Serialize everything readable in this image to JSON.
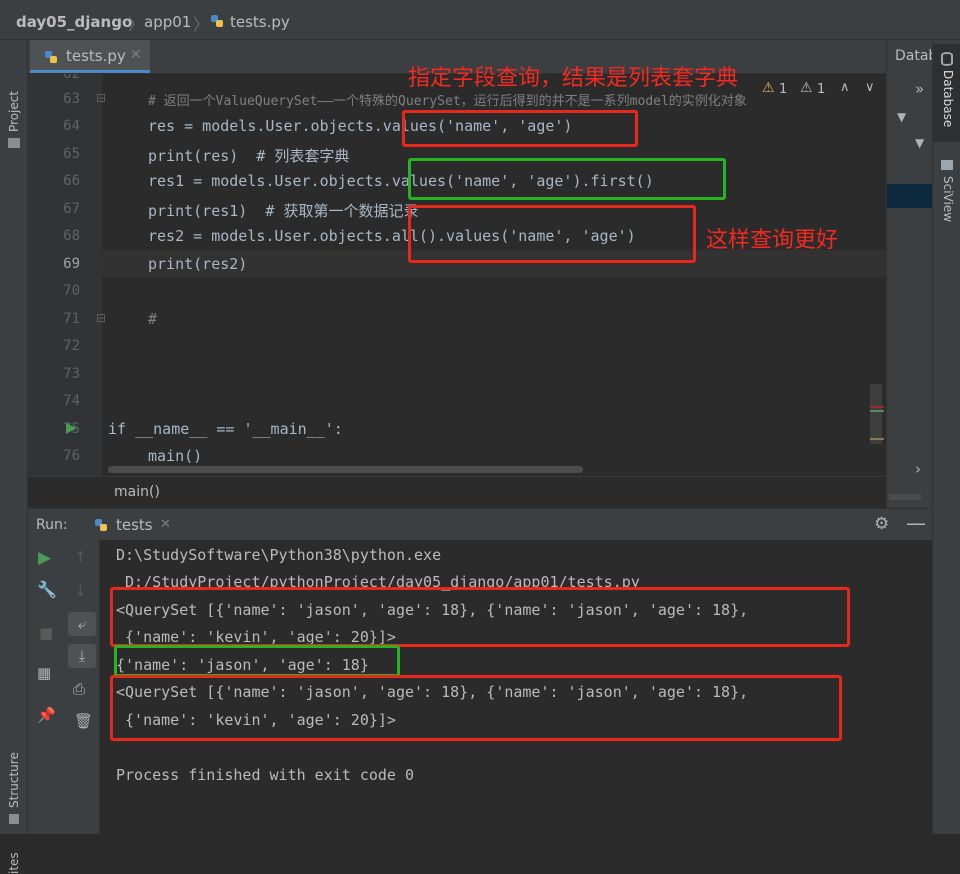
{
  "navbar": {
    "project": "day05_django",
    "module": "app01",
    "file": "tests.py",
    "warn1": "1",
    "warn2": "1"
  },
  "left_toolwindows": {
    "project": "Project",
    "structure": "Structure",
    "favorites": "ites"
  },
  "right_toolwindows": {
    "database": "Database",
    "sciview": "SciView",
    "panel_title": "Datab"
  },
  "editor": {
    "tab_label": "tests.py",
    "lines": [
      {
        "num": "62",
        "text": ""
      },
      {
        "num": "63",
        "text": "# 返回一个ValueQuerySet——一个特殊的QuerySet，运行后得到的并不是一系列model的实例化对象"
      },
      {
        "num": "64",
        "text": "res = models.User.objects.values('name', 'age')"
      },
      {
        "num": "65",
        "text": "print(res)  # 列表套字典"
      },
      {
        "num": "66",
        "text": "res1 = models.User.objects.values('name', 'age').first()"
      },
      {
        "num": "67",
        "text": "print(res1)  # 获取第一个数据记录"
      },
      {
        "num": "68",
        "text": "res2 = models.User.objects.all().values('name', 'age')"
      },
      {
        "num": "69",
        "text": "print(res2)"
      },
      {
        "num": "70",
        "text": ""
      },
      {
        "num": "71",
        "text": "#"
      },
      {
        "num": "72",
        "text": ""
      },
      {
        "num": "73",
        "text": ""
      },
      {
        "num": "74",
        "text": ""
      },
      {
        "num": "75",
        "text": "if __name__ == '__main__':"
      },
      {
        "num": "76",
        "text": "main()"
      }
    ],
    "breadcrumb": "main()"
  },
  "annotations": {
    "top": "指定字段查询，结果是列表套字典",
    "right": "这样查询更好"
  },
  "run": {
    "label": "Run:",
    "tab": "tests",
    "output": [
      "D:\\StudySoftware\\Python38\\python.exe",
      " D:/StudyProject/pythonProject/day05_django/app01/tests.py",
      "<QuerySet [{'name': 'jason', 'age': 18}, {'name': 'jason', 'age': 18},",
      " {'name': 'kevin', 'age': 20}]>",
      "{'name': 'jason', 'age': 18}",
      "<QuerySet [{'name': 'jason', 'age': 18}, {'name': 'jason', 'age': 18},",
      " {'name': 'kevin', 'age': 20}]>",
      "",
      "Process finished with exit code 0"
    ]
  },
  "colors": {
    "red_box": "#e8271d",
    "green_box": "#27b423",
    "annotation": "#f5291f"
  }
}
